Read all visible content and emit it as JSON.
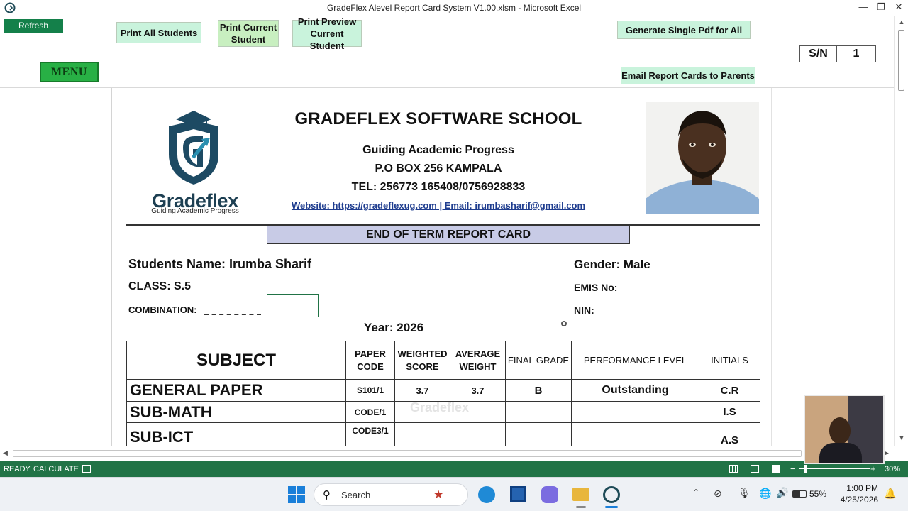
{
  "window": {
    "title": "GradeFlex Alevel Report Card System V1.00.xlsm - Microsoft Excel"
  },
  "toolbar": {
    "refresh": "Refresh",
    "menu": "MENU",
    "print_all": "Print All Students",
    "print_current_1": "Print Current",
    "print_current_2": "Student",
    "print_preview_1": "Print Preview",
    "print_preview_2": "Current Student",
    "generate_pdf": "Generate Single  Pdf for All",
    "email_cards": "Email Report Cards to Parents",
    "sn_label": "S/N",
    "sn_value": "1"
  },
  "colors": {
    "accent_green": "#217346",
    "menu_green": "#28b045",
    "button_mint": "#c9f3dc",
    "banner_gray": "#c8cbe6",
    "link_blue": "#1f3d8f"
  },
  "school": {
    "name": "GRADEFLEX SOFTWARE SCHOOL",
    "motto": "Guiding Academic Progress",
    "address": "P.O BOX 256 KAMPALA",
    "tel": "TEL: 256773 165408/0756928833",
    "web": "Website: https://gradeflexug.com | Email: irumbasharif@gmail.com",
    "logo_name": "Gradeflex",
    "logo_tagline": "Guiding Academic Progress"
  },
  "report": {
    "banner": "END OF TERM REPORT CARD",
    "student_name": "Students Name: Irumba  Sharif",
    "class": "CLASS: S.5",
    "combination_label": "COMBINATION:",
    "gender": "Gender: Male",
    "emis": "EMIS No:",
    "nin": "NIN:",
    "year": "Year: 2026"
  },
  "table": {
    "headers": {
      "subject": "SUBJECT",
      "paper_code_1": "PAPER",
      "paper_code_2": "CODE",
      "weighted_1": "WEIGHTED",
      "weighted_2": "SCORE",
      "average_1": "AVERAGE",
      "average_2": "WEIGHT",
      "final": "FINAL GRADE",
      "performance": "PERFORMANCE LEVEL",
      "initials": "INITIALS"
    },
    "rows": [
      {
        "subject": "GENERAL PAPER",
        "code": "S101/1",
        "weighted": "3.7",
        "average": "3.7",
        "grade": "B",
        "performance": "Outstanding",
        "initials": "C.R"
      },
      {
        "subject": "SUB-MATH",
        "code": "CODE/1",
        "weighted": "",
        "average": "",
        "grade": "",
        "performance": "",
        "initials": "I.S"
      },
      {
        "subject": "SUB-ICT",
        "code": "CODE3/1",
        "weighted": "",
        "average": "",
        "grade": "",
        "performance": "",
        "initials": "A.S"
      }
    ],
    "watermark": "Gradeflex"
  },
  "statusbar": {
    "ready": "READY",
    "calculate": "CALCULATE",
    "zoom": "30%"
  },
  "taskbar": {
    "search": "Search",
    "battery": "55%",
    "time": "1:00 PM",
    "date": "4/25/2026"
  }
}
